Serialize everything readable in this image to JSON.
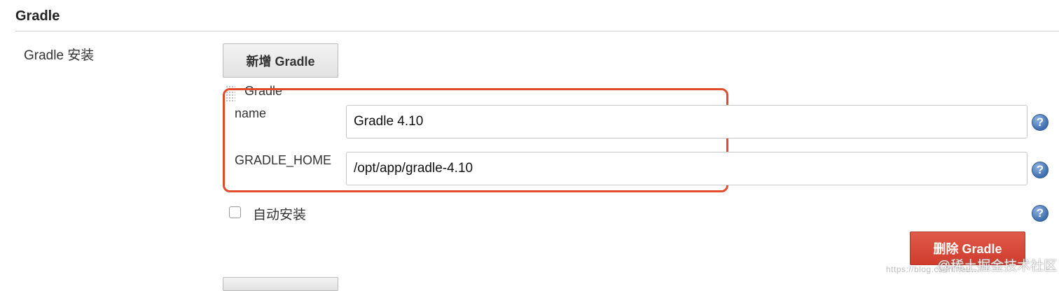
{
  "section": {
    "title": "Gradle"
  },
  "installations": {
    "label": "Gradle 安装",
    "add_button": "新增 Gradle",
    "item": {
      "title": "Gradle",
      "name_label": "name",
      "name_value": "Gradle 4.10",
      "home_label": "GRADLE_HOME",
      "home_value": "/opt/app/gradle-4.10",
      "auto_install_label": "自动安装",
      "auto_install_checked": false,
      "delete_button": "删除 Gradle",
      "help_glyph": "?"
    },
    "highlight_color": "#e34b2d"
  },
  "watermark": {
    "text": "@稀土掘金技术社区",
    "url_fragment": "https://blog.csdn.net/..."
  },
  "icons": [
    "help-icon",
    "drag-handle-icon"
  ]
}
